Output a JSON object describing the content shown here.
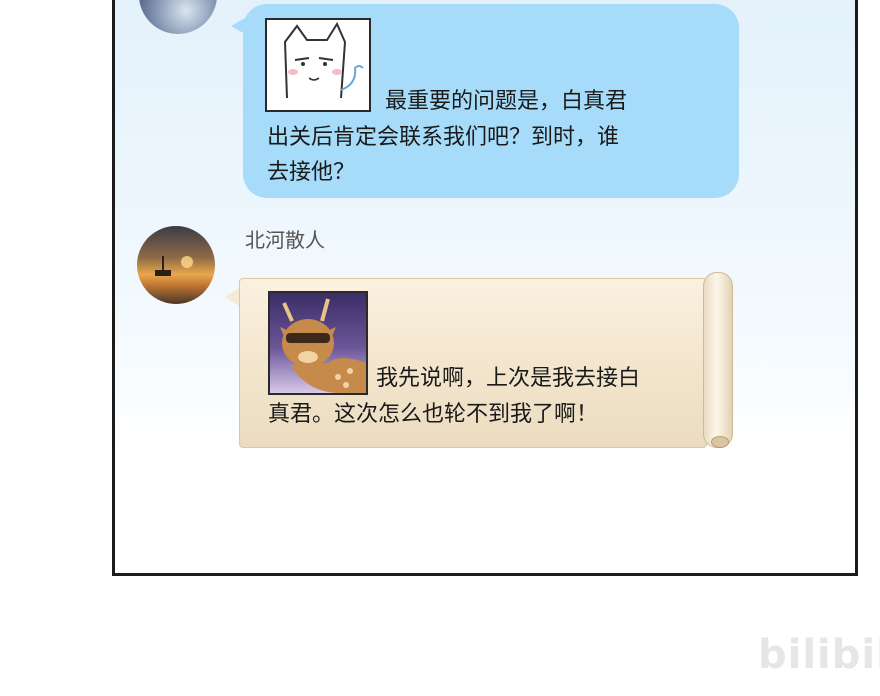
{
  "conversation": {
    "message1": {
      "line1": "最重要的问题是，白真君",
      "line2": "出关后肯定会联系我们吧？到时，谁",
      "line3": "去接他？",
      "sticker": "cat-sticker"
    },
    "message2": {
      "username": "北河散人",
      "line1": "我先说啊，上次是我去接白",
      "line2": "真君。这次怎么也轮不到我了啊！",
      "sticker": "deer-sticker"
    }
  },
  "watermark": "bilibili",
  "colors": {
    "bubble_blue": "#a6dcf9",
    "scroll_paper": "#f2e5cc",
    "panel_border": "#1b1b1b"
  }
}
